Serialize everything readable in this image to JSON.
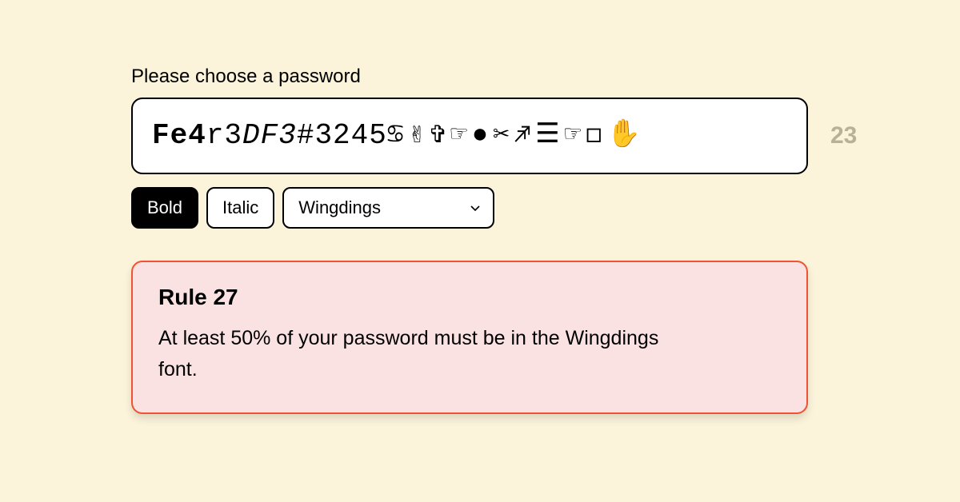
{
  "prompt": "Please choose a password",
  "char_count": "23",
  "password_segments": [
    {
      "text": "Fe4",
      "classes": "mono bold"
    },
    {
      "text": "r3",
      "classes": "mono"
    },
    {
      "text": "DF3",
      "classes": "mono italic"
    },
    {
      "text": "#3245",
      "classes": "mono"
    },
    {
      "text": "♋✌✞☞●✂♐☰☞◻✋",
      "classes": "wd"
    }
  ],
  "toolbar": {
    "bold_label": "Bold",
    "italic_label": "Italic",
    "font_select": "Wingdings"
  },
  "rule": {
    "title": "Rule 27",
    "body": "At least 50% of your password must be in the Wingdings font."
  }
}
